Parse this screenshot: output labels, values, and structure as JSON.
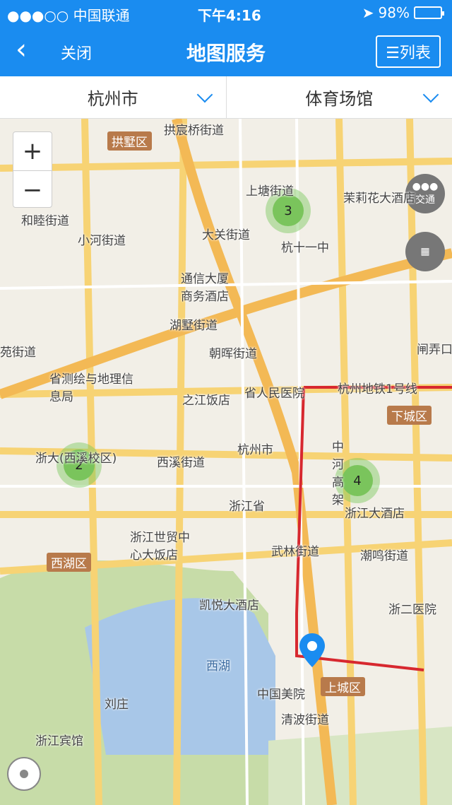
{
  "status_bar": {
    "carrier": "●●●○○ 中国联通",
    "time": "下午4:16",
    "battery": "98%"
  },
  "nav": {
    "back_icon": "chevron-left-icon",
    "close_label": "关闭",
    "title": "地图服务",
    "list_label": "☰列表"
  },
  "filters": {
    "city": "杭州市",
    "category": "体育场馆"
  },
  "map": {
    "zoom_in": "+",
    "zoom_out": "−",
    "traffic_label": "交通",
    "clusters": [
      "3",
      "2",
      "4"
    ],
    "labels": [
      "拱宸桥街道",
      "上塘街道",
      "茉莉花大酒店",
      "和睦街道",
      "小河街道",
      "大关街道",
      "杭十一中",
      "通信大厦商务酒店",
      "湖墅街道",
      "朝晖街道",
      "省测绘与地理信息局",
      "之江饭店",
      "省人民医院",
      "杭州地铁1号线",
      "西溪街道",
      "杭州市",
      "浙江省",
      "浙江大酒店",
      "浙江世贸中心大饭店",
      "武林街道",
      "潮鸣街道",
      "凯悦大酒店",
      "浙二医院",
      "西湖",
      "中国美院",
      "清波街道",
      "刘庄",
      "浙江宾馆",
      "闸弄口",
      "苑街道",
      "浙大(西溪校区)",
      "中河高架"
    ],
    "districts": [
      "拱墅区",
      "下城区",
      "西湖区",
      "上城区"
    ]
  }
}
